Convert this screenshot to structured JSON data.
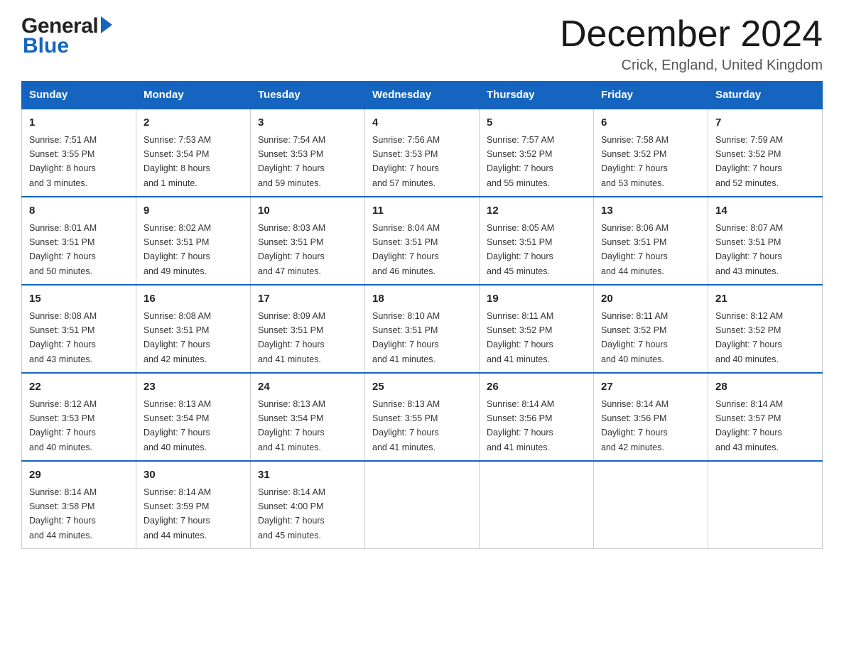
{
  "header": {
    "logo_general": "General",
    "logo_blue": "Blue",
    "main_title": "December 2024",
    "subtitle": "Crick, England, United Kingdom"
  },
  "columns": [
    "Sunday",
    "Monday",
    "Tuesday",
    "Wednesday",
    "Thursday",
    "Friday",
    "Saturday"
  ],
  "weeks": [
    [
      {
        "day": "1",
        "info": "Sunrise: 7:51 AM\nSunset: 3:55 PM\nDaylight: 8 hours\nand 3 minutes."
      },
      {
        "day": "2",
        "info": "Sunrise: 7:53 AM\nSunset: 3:54 PM\nDaylight: 8 hours\nand 1 minute."
      },
      {
        "day": "3",
        "info": "Sunrise: 7:54 AM\nSunset: 3:53 PM\nDaylight: 7 hours\nand 59 minutes."
      },
      {
        "day": "4",
        "info": "Sunrise: 7:56 AM\nSunset: 3:53 PM\nDaylight: 7 hours\nand 57 minutes."
      },
      {
        "day": "5",
        "info": "Sunrise: 7:57 AM\nSunset: 3:52 PM\nDaylight: 7 hours\nand 55 minutes."
      },
      {
        "day": "6",
        "info": "Sunrise: 7:58 AM\nSunset: 3:52 PM\nDaylight: 7 hours\nand 53 minutes."
      },
      {
        "day": "7",
        "info": "Sunrise: 7:59 AM\nSunset: 3:52 PM\nDaylight: 7 hours\nand 52 minutes."
      }
    ],
    [
      {
        "day": "8",
        "info": "Sunrise: 8:01 AM\nSunset: 3:51 PM\nDaylight: 7 hours\nand 50 minutes."
      },
      {
        "day": "9",
        "info": "Sunrise: 8:02 AM\nSunset: 3:51 PM\nDaylight: 7 hours\nand 49 minutes."
      },
      {
        "day": "10",
        "info": "Sunrise: 8:03 AM\nSunset: 3:51 PM\nDaylight: 7 hours\nand 47 minutes."
      },
      {
        "day": "11",
        "info": "Sunrise: 8:04 AM\nSunset: 3:51 PM\nDaylight: 7 hours\nand 46 minutes."
      },
      {
        "day": "12",
        "info": "Sunrise: 8:05 AM\nSunset: 3:51 PM\nDaylight: 7 hours\nand 45 minutes."
      },
      {
        "day": "13",
        "info": "Sunrise: 8:06 AM\nSunset: 3:51 PM\nDaylight: 7 hours\nand 44 minutes."
      },
      {
        "day": "14",
        "info": "Sunrise: 8:07 AM\nSunset: 3:51 PM\nDaylight: 7 hours\nand 43 minutes."
      }
    ],
    [
      {
        "day": "15",
        "info": "Sunrise: 8:08 AM\nSunset: 3:51 PM\nDaylight: 7 hours\nand 43 minutes."
      },
      {
        "day": "16",
        "info": "Sunrise: 8:08 AM\nSunset: 3:51 PM\nDaylight: 7 hours\nand 42 minutes."
      },
      {
        "day": "17",
        "info": "Sunrise: 8:09 AM\nSunset: 3:51 PM\nDaylight: 7 hours\nand 41 minutes."
      },
      {
        "day": "18",
        "info": "Sunrise: 8:10 AM\nSunset: 3:51 PM\nDaylight: 7 hours\nand 41 minutes."
      },
      {
        "day": "19",
        "info": "Sunrise: 8:11 AM\nSunset: 3:52 PM\nDaylight: 7 hours\nand 41 minutes."
      },
      {
        "day": "20",
        "info": "Sunrise: 8:11 AM\nSunset: 3:52 PM\nDaylight: 7 hours\nand 40 minutes."
      },
      {
        "day": "21",
        "info": "Sunrise: 8:12 AM\nSunset: 3:52 PM\nDaylight: 7 hours\nand 40 minutes."
      }
    ],
    [
      {
        "day": "22",
        "info": "Sunrise: 8:12 AM\nSunset: 3:53 PM\nDaylight: 7 hours\nand 40 minutes."
      },
      {
        "day": "23",
        "info": "Sunrise: 8:13 AM\nSunset: 3:54 PM\nDaylight: 7 hours\nand 40 minutes."
      },
      {
        "day": "24",
        "info": "Sunrise: 8:13 AM\nSunset: 3:54 PM\nDaylight: 7 hours\nand 41 minutes."
      },
      {
        "day": "25",
        "info": "Sunrise: 8:13 AM\nSunset: 3:55 PM\nDaylight: 7 hours\nand 41 minutes."
      },
      {
        "day": "26",
        "info": "Sunrise: 8:14 AM\nSunset: 3:56 PM\nDaylight: 7 hours\nand 41 minutes."
      },
      {
        "day": "27",
        "info": "Sunrise: 8:14 AM\nSunset: 3:56 PM\nDaylight: 7 hours\nand 42 minutes."
      },
      {
        "day": "28",
        "info": "Sunrise: 8:14 AM\nSunset: 3:57 PM\nDaylight: 7 hours\nand 43 minutes."
      }
    ],
    [
      {
        "day": "29",
        "info": "Sunrise: 8:14 AM\nSunset: 3:58 PM\nDaylight: 7 hours\nand 44 minutes."
      },
      {
        "day": "30",
        "info": "Sunrise: 8:14 AM\nSunset: 3:59 PM\nDaylight: 7 hours\nand 44 minutes."
      },
      {
        "day": "31",
        "info": "Sunrise: 8:14 AM\nSunset: 4:00 PM\nDaylight: 7 hours\nand 45 minutes."
      },
      null,
      null,
      null,
      null
    ]
  ]
}
